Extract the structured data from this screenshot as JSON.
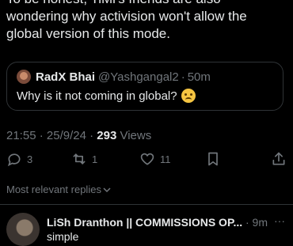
{
  "tweet": {
    "body": "To be honest, TiMi's friends are also wondering why activision won't allow the global version of this mode."
  },
  "quote": {
    "name": "RadX Bhai",
    "handle": "@Yashgangal2",
    "dot": "·",
    "time": "50m",
    "text": "Why is it not coming in global?",
    "emoji": "crying-face"
  },
  "meta": {
    "time": "21:55",
    "dot": "·",
    "date": "25/9/24",
    "views_count": "293",
    "views_label": "Views"
  },
  "actions": {
    "replies": "3",
    "reposts": "1",
    "likes": "11"
  },
  "replies_sort": {
    "label": "Most relevant replies"
  },
  "reply": {
    "name": "LiSh Dranthon || COMMISSIONS OP...",
    "time": "· 9m",
    "more": "···",
    "text": "simple"
  },
  "colors": {
    "background": "#000000",
    "text": "#e7e9ea",
    "muted": "#71767b",
    "border": "#2f3336"
  }
}
